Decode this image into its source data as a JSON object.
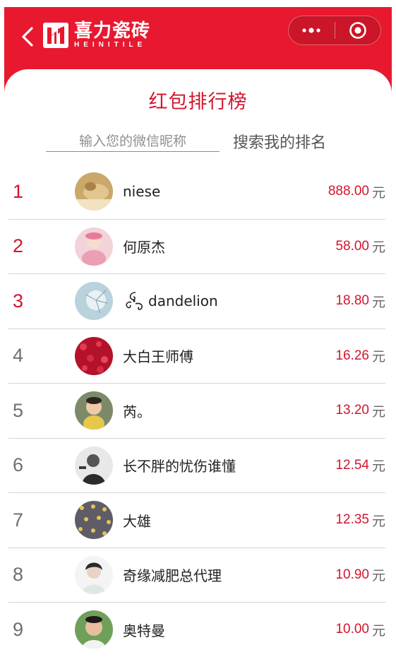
{
  "header": {
    "logo_cn": "喜力瓷砖",
    "logo_en": "HEINITILE",
    "colors": {
      "brand": "#e8182f",
      "accent": "#d2152e"
    }
  },
  "page": {
    "title": "红包排行榜",
    "search_placeholder": "输入您的微信昵称",
    "search_button": "搜索我的排名"
  },
  "ranking": [
    {
      "rank": "1",
      "name": "niese",
      "amount": "888.00",
      "unit": "元"
    },
    {
      "rank": "2",
      "name": "何原杰",
      "amount": "58.00",
      "unit": "元"
    },
    {
      "rank": "3",
      "name": "dandelion",
      "amount": "18.80",
      "unit": "元"
    },
    {
      "rank": "4",
      "name": "大白王师傅",
      "amount": "16.26",
      "unit": "元"
    },
    {
      "rank": "5",
      "name": "芮。",
      "amount": "13.20",
      "unit": "元"
    },
    {
      "rank": "6",
      "name": "长不胖的忧伤谁懂",
      "amount": "12.54",
      "unit": "元"
    },
    {
      "rank": "7",
      "name": "大雄",
      "amount": "12.35",
      "unit": "元"
    },
    {
      "rank": "8",
      "name": "奇缘减肥总代理",
      "amount": "10.90",
      "unit": "元"
    },
    {
      "rank": "9",
      "name": "奥特曼",
      "amount": "10.00",
      "unit": "元"
    }
  ]
}
